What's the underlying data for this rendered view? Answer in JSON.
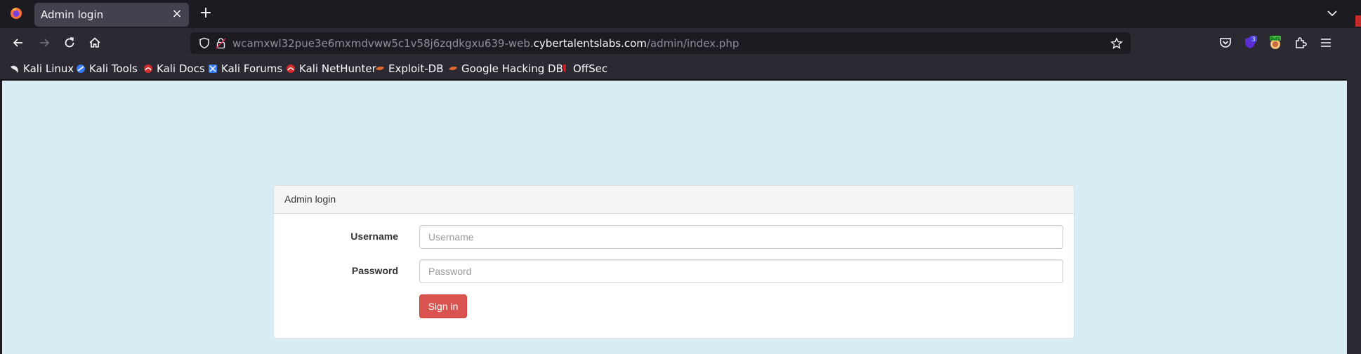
{
  "browser": {
    "tab": {
      "title": "Admin login"
    },
    "url": {
      "prefix": "wcamxwl32pue3e6mxmdvww5c1v58j6zqdkgxu639-web.",
      "domain": "cybertalentslabs.com",
      "path": "/admin/index.php"
    },
    "extension_badges": {
      "ublock_count": "3",
      "burp_label": "Burp"
    },
    "bookmarks": [
      {
        "label": "Kali Linux",
        "icon": "kali-dragon-icon"
      },
      {
        "label": "Kali Tools",
        "icon": "kali-tools-icon"
      },
      {
        "label": "Kali Docs",
        "icon": "kali-docs-icon"
      },
      {
        "label": "Kali Forums",
        "icon": "kali-forums-icon"
      },
      {
        "label": "Kali NetHunter",
        "icon": "kali-nethunter-icon"
      },
      {
        "label": "Exploit-DB",
        "icon": "exploit-db-icon"
      },
      {
        "label": "Google Hacking DB",
        "icon": "ghdb-icon"
      },
      {
        "label": "OffSec",
        "icon": "offsec-icon"
      }
    ]
  },
  "login": {
    "heading": "Admin login",
    "username_label": "Username",
    "username_placeholder": "Username",
    "password_label": "Password",
    "password_placeholder": "Password",
    "submit_label": "Sign in"
  },
  "colors": {
    "page_bg": "#d8ecf4",
    "button": "#d9534f",
    "browser_chrome": "#2b2a33"
  }
}
